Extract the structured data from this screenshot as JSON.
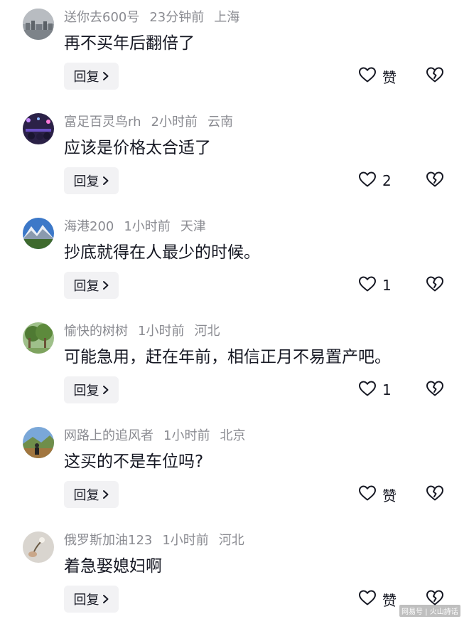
{
  "reply_label": "回复",
  "comments": [
    {
      "user": "送你去600号",
      "time": "23分钟前",
      "location": "上海",
      "text": "再不买年后翻倍了",
      "like_count": "赞",
      "avatar": "city-skyline-photo"
    },
    {
      "user": "富足百灵鸟rh",
      "time": "2小时前",
      "location": "云南",
      "text": "应该是价格太合适了",
      "like_count": "2",
      "avatar": "night-crowd-photo"
    },
    {
      "user": "海港200",
      "time": "1小时前",
      "location": "天津",
      "text": "抄底就得在人最少的时候。",
      "like_count": "1",
      "avatar": "snow-mountain-photo"
    },
    {
      "user": "愉快的树树",
      "time": "1小时前",
      "location": "河北",
      "text": "可能急用，赶在年前，相信正月不易置产吧。",
      "like_count": "1",
      "avatar": "tree-photo"
    },
    {
      "user": "网路上的追风者",
      "time": "1小时前",
      "location": "北京",
      "text": "这买的不是车位吗?",
      "like_count": "赞",
      "avatar": "landscape-person-photo"
    },
    {
      "user": "俄罗斯加油123",
      "time": "1小时前",
      "location": "河北",
      "text": "着急娶媳妇啊",
      "like_count": "赞",
      "avatar": "hand-flower-photo"
    }
  ],
  "icons": {
    "like": "heart-outline-icon",
    "dislike": "broken-heart-icon",
    "reply_chevron": "chevron-right-icon"
  },
  "watermark": "网易号 | 火山詩话",
  "colors": {
    "text": "#161823",
    "meta": "#8a8b91",
    "reply_bg": "#f2f2f4",
    "icon": "#161823"
  }
}
